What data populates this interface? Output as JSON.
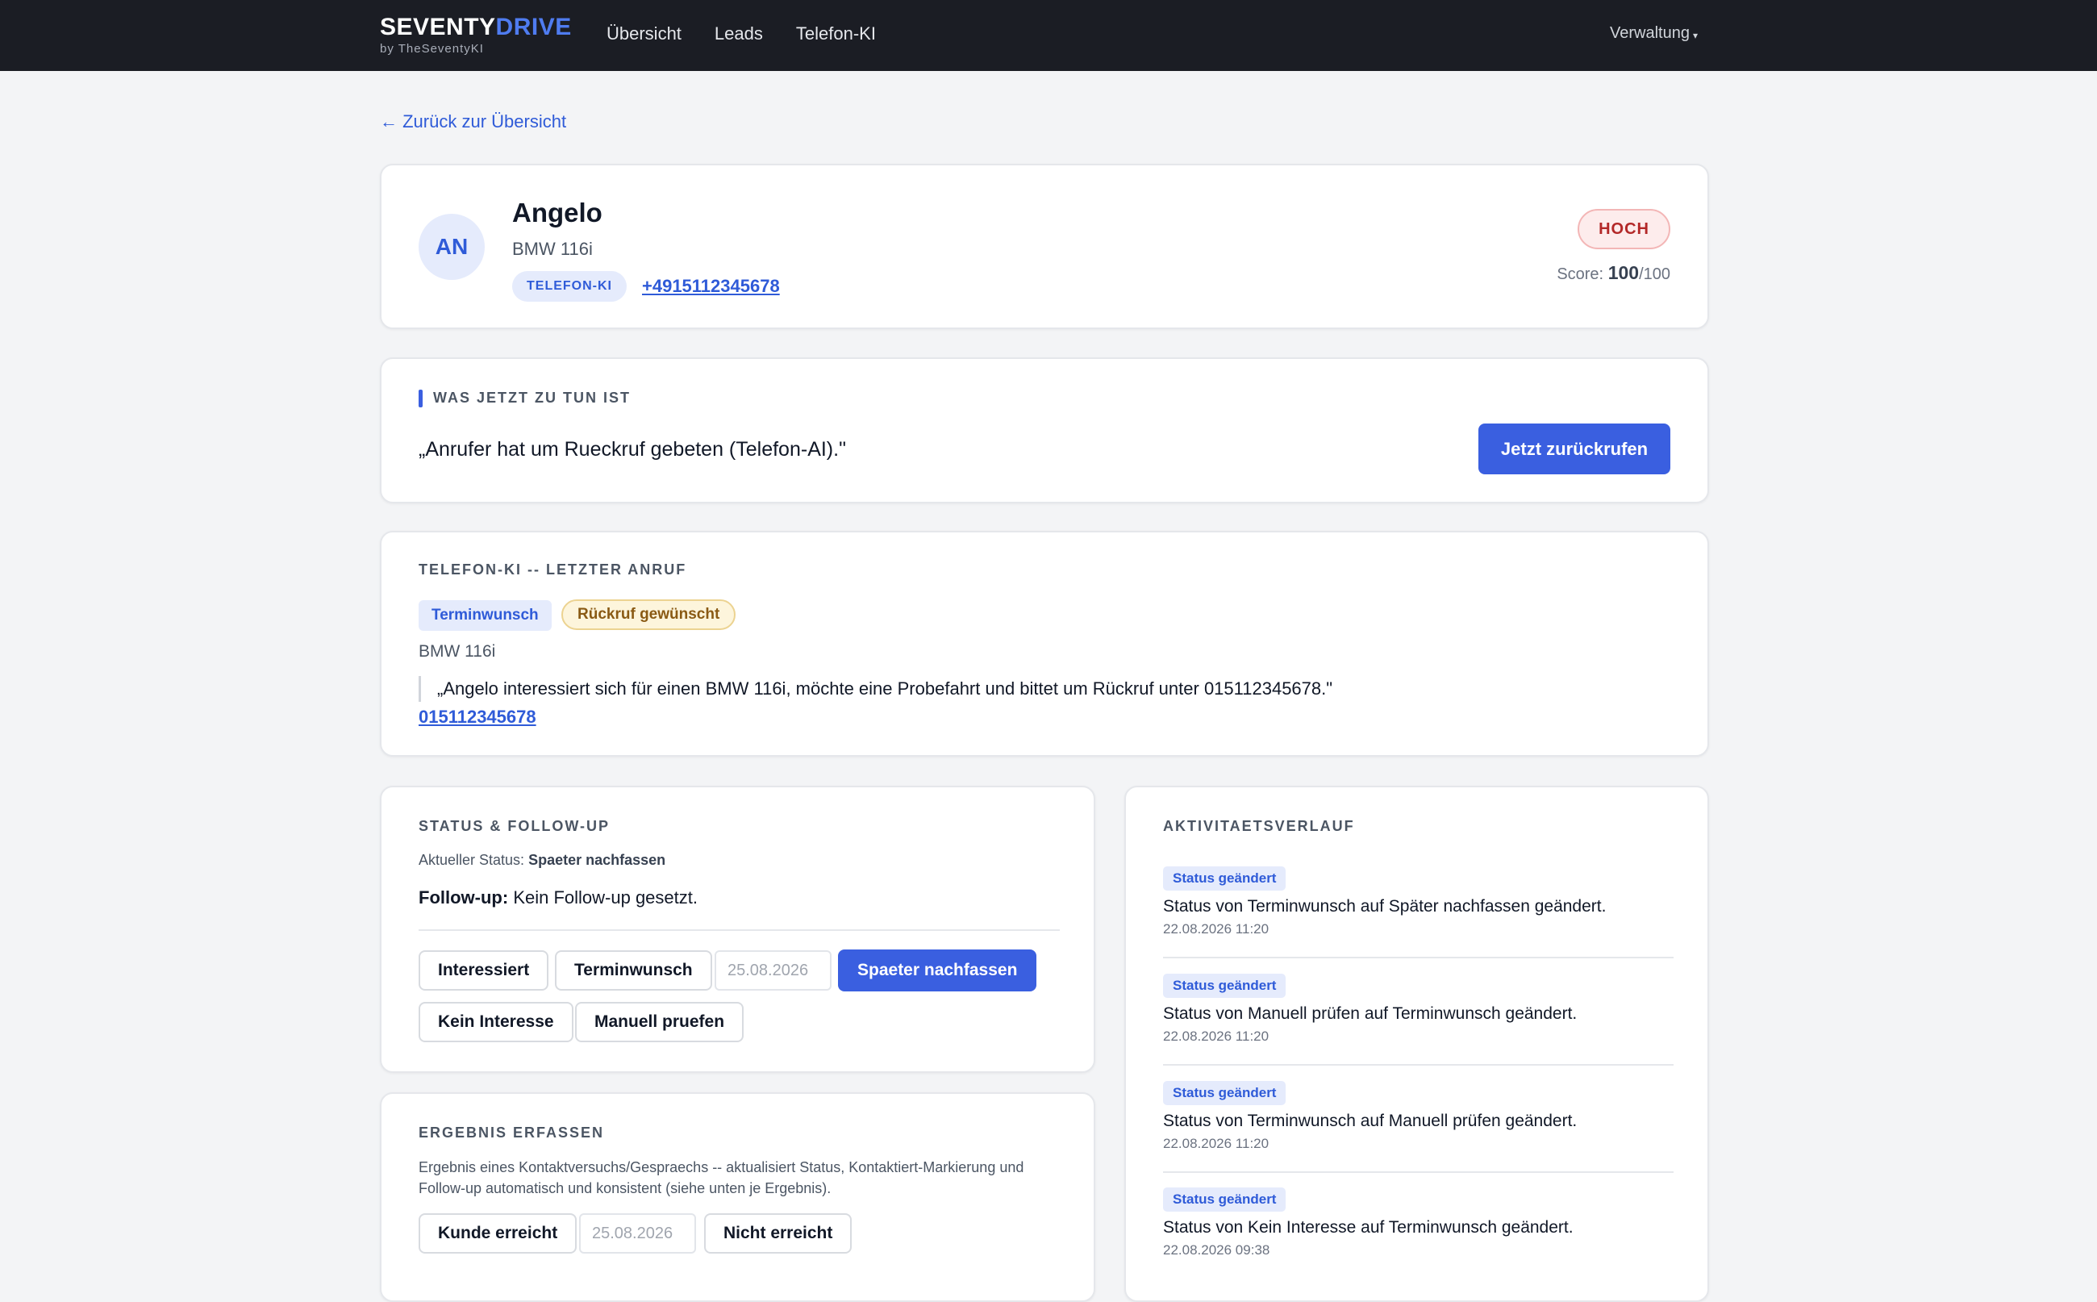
{
  "brand": {
    "name_main": "SEVENTY",
    "name_accent": "DRIVE",
    "subtitle": "by TheSeventyKI"
  },
  "nav": {
    "items": [
      "Übersicht",
      "Leads",
      "Telefon-KI"
    ],
    "admin_label": "Verwaltung",
    "admin_caret": "▾"
  },
  "back_link": "← Zurück zur Übersicht",
  "lead": {
    "initials": "AN",
    "name": "Angelo",
    "car": "BMW 116i",
    "source_badge": "TELEFON-KI",
    "phone": "+4915112345678",
    "priority": "HOCH",
    "score_label": "Score:",
    "score_value": "100",
    "score_max": "/100"
  },
  "action": {
    "title": "WAS JETZT ZU TUN IST",
    "text": "„Anrufer hat um Rueckruf gebeten (Telefon-AI).\"",
    "button": "Jetzt zurückrufen"
  },
  "call": {
    "title": "TELEFON-KI -- LETZTER ANRUF",
    "tag_intent": "Terminwunsch",
    "tag_callback": "Rückruf gewünscht",
    "car": "BMW 116i",
    "quote": "„Angelo interessiert sich für einen BMW 116i, möchte eine Probefahrt und bittet um Rückruf unter 015112345678.\"",
    "phone": "015112345678"
  },
  "status": {
    "title": "STATUS & FOLLOW-UP",
    "current_label": "Aktueller Status:",
    "current_value": "Spaeter nachfassen",
    "followup_label": "Follow-up:",
    "followup_value": "Kein Follow-up gesetzt.",
    "btn_interested": "Interessiert",
    "btn_appointment": "Terminwunsch",
    "date_value": "25.08.2026",
    "btn_later": "Spaeter nachfassen",
    "btn_no_interest": "Kein Interesse",
    "btn_manual": "Manuell pruefen"
  },
  "result": {
    "title": "ERGEBNIS ERFASSEN",
    "description": "Ergebnis eines Kontaktversuchs/Gespraechs -- aktualisiert Status, Kontaktiert-Markierung und Follow-up automatisch und konsistent (siehe unten je Ergebnis).",
    "btn_reached": "Kunde erreicht",
    "date_value": "25.08.2026",
    "btn_not_reached": "Nicht erreicht"
  },
  "activity": {
    "title": "AKTIVITAETSVERLAUF",
    "items": [
      {
        "badge": "Status geändert",
        "text": "Status von Terminwunsch auf Später nachfassen geändert.",
        "time": "22.08.2026 11:20"
      },
      {
        "badge": "Status geändert",
        "text": "Status von Manuell prüfen auf Terminwunsch geändert.",
        "time": "22.08.2026 11:20"
      },
      {
        "badge": "Status geändert",
        "text": "Status von Terminwunsch auf Manuell prüfen geändert.",
        "time": "22.08.2026 11:20"
      },
      {
        "badge": "Status geändert",
        "text": "Status von Kein Interesse auf Terminwunsch geändert.",
        "time": "22.08.2026 09:38"
      }
    ]
  }
}
